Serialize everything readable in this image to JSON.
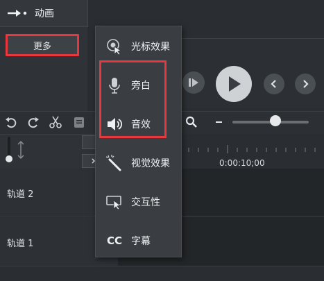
{
  "sidebar": {
    "animation_label": "动画",
    "more_label": "更多"
  },
  "menu": {
    "items": [
      {
        "label": "光标效果",
        "icon": "cursor-effect-icon"
      },
      {
        "label": "旁白",
        "icon": "microphone-icon"
      },
      {
        "label": "音效",
        "icon": "speaker-icon"
      },
      {
        "label": "视觉效果",
        "icon": "magic-wand-icon"
      },
      {
        "label": "交互性",
        "icon": "interactive-icon"
      },
      {
        "label": "字幕",
        "icon": "cc-icon"
      }
    ],
    "cc_glyph": "CC"
  },
  "timeline": {
    "time_marker": "0:00:10;00",
    "tracks": [
      {
        "label": "轨道 2"
      },
      {
        "label": "轨道 1"
      }
    ]
  },
  "colors": {
    "highlight": "#e8383d",
    "menu_bg": "#3a3e42",
    "panel_bg": "#2f3337"
  }
}
